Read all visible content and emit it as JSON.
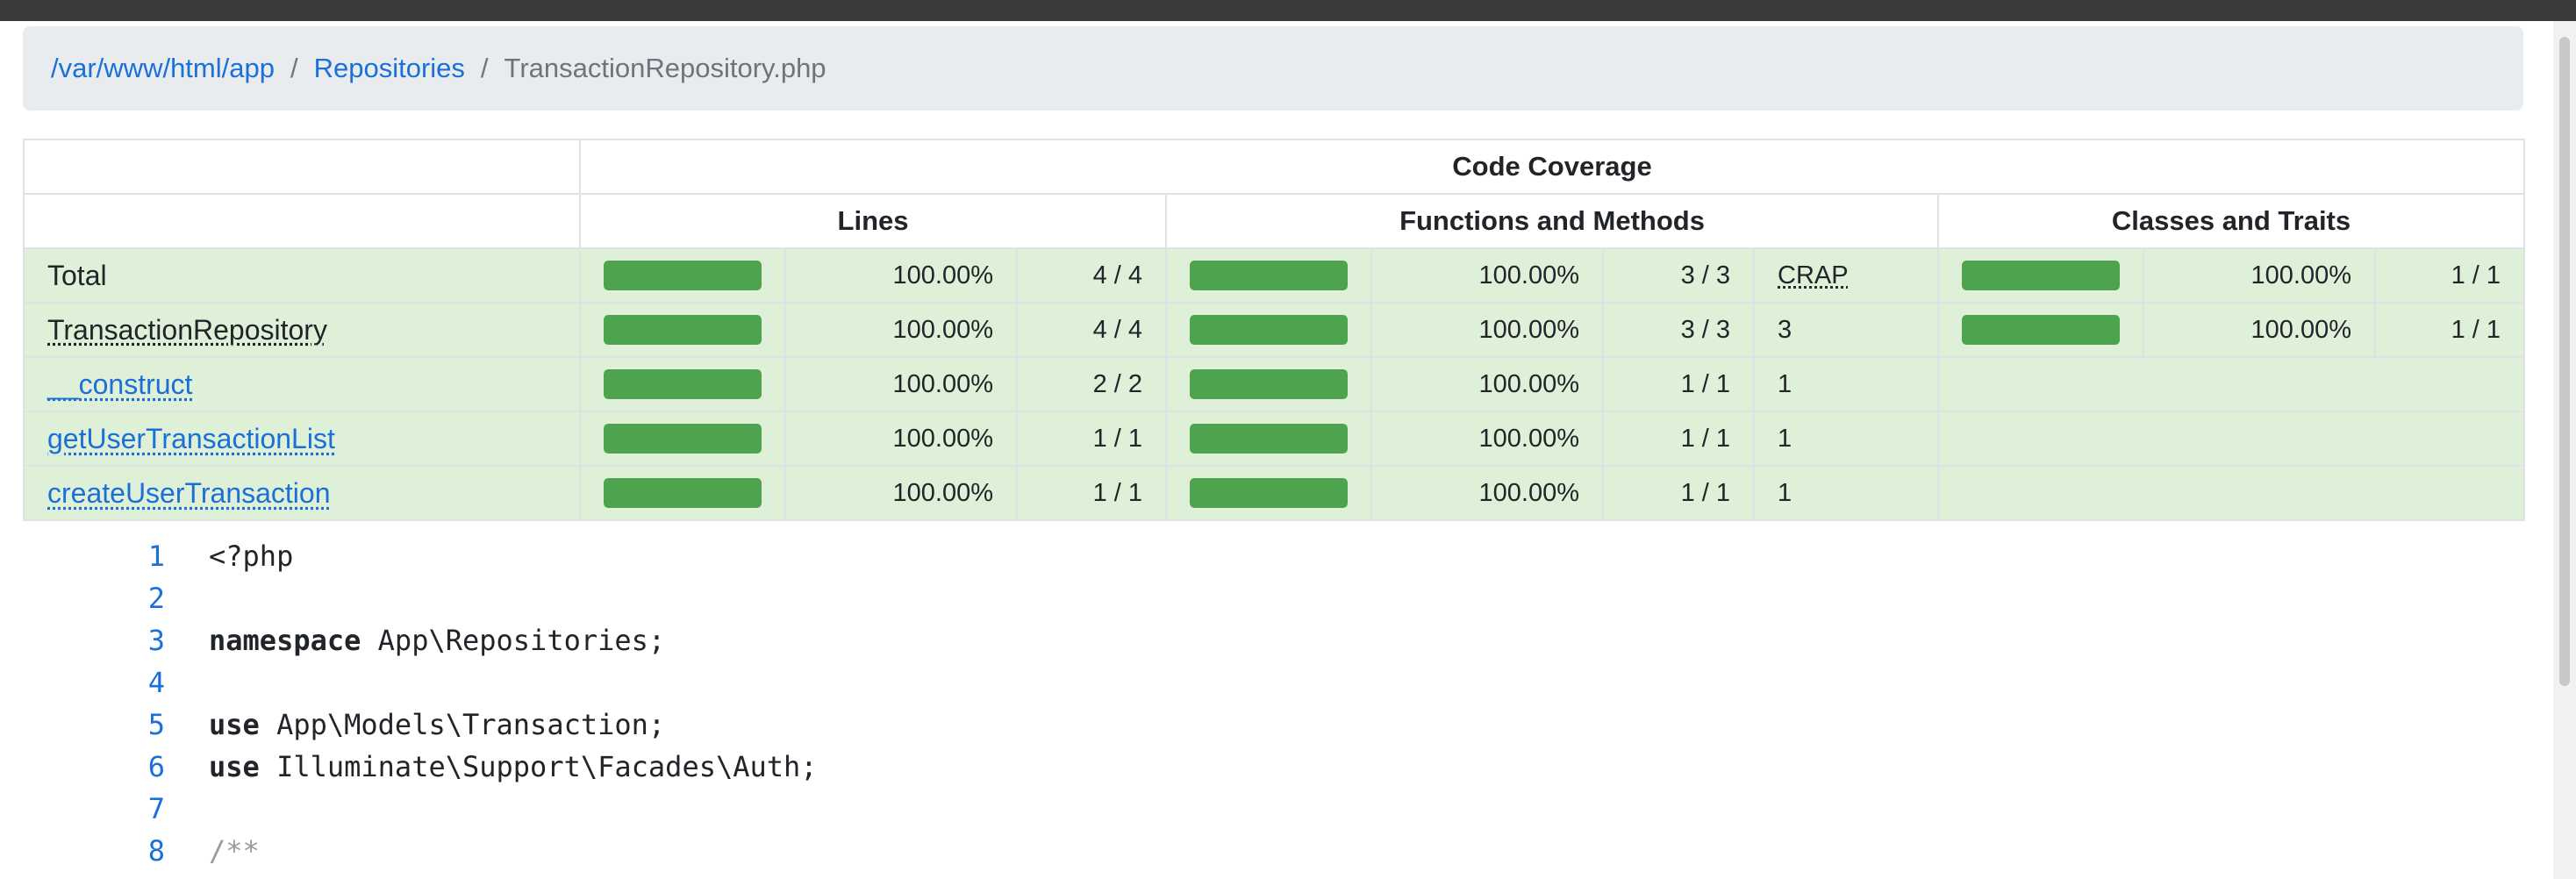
{
  "breadcrumb": {
    "root": "/var/www/html/app",
    "folder": "Repositories",
    "current": "TransactionRepository.php",
    "separator": "/"
  },
  "table": {
    "header_main": "Code Coverage",
    "columns": {
      "lines": "Lines",
      "functions": "Functions and Methods",
      "classes": "Classes and Traits"
    },
    "rows": [
      {
        "name": "Total",
        "lines_pct": "100.00%",
        "lines_ratio": "4 / 4",
        "lines_fill": 1.0,
        "fn_pct": "100.00%",
        "fn_ratio": "3 / 3",
        "crap": "CRAP",
        "fn_fill": 1.0,
        "cls_pct": "100.00%",
        "cls_ratio": "1 / 1",
        "cls_fill": 1.0
      },
      {
        "name": "TransactionRepository",
        "lines_pct": "100.00%",
        "lines_ratio": "4 / 4",
        "lines_fill": 1.0,
        "fn_pct": "100.00%",
        "fn_ratio": "3 / 3",
        "crap": "3",
        "fn_fill": 1.0,
        "cls_pct": "100.00%",
        "cls_ratio": "1 / 1",
        "cls_fill": 1.0
      },
      {
        "name": "__construct",
        "lines_pct": "100.00%",
        "lines_ratio": "2 / 2",
        "lines_fill": 1.0,
        "fn_pct": "100.00%",
        "fn_ratio": "1 / 1",
        "crap": "1",
        "fn_fill": 1.0
      },
      {
        "name": "getUserTransactionList",
        "lines_pct": "100.00%",
        "lines_ratio": "1 / 1",
        "lines_fill": 1.0,
        "fn_pct": "100.00%",
        "fn_ratio": "1 / 1",
        "crap": "1",
        "fn_fill": 1.0
      },
      {
        "name": "createUserTransaction",
        "lines_pct": "100.00%",
        "lines_ratio": "1 / 1",
        "lines_fill": 1.0,
        "fn_pct": "100.00%",
        "fn_ratio": "1 / 1",
        "crap": "1",
        "fn_fill": 1.0
      }
    ]
  },
  "code": {
    "lines": [
      {
        "n": "1",
        "kw": "",
        "text": "<?php"
      },
      {
        "n": "2",
        "kw": "",
        "text": ""
      },
      {
        "n": "3",
        "kw": "namespace",
        "text": " App\\Repositories;"
      },
      {
        "n": "4",
        "kw": "",
        "text": ""
      },
      {
        "n": "5",
        "kw": "use",
        "text": " App\\Models\\Transaction;"
      },
      {
        "n": "6",
        "kw": "use",
        "text": " Illuminate\\Support\\Facades\\Auth;"
      },
      {
        "n": "7",
        "kw": "",
        "text": ""
      },
      {
        "n": "8",
        "kw": "",
        "comment": "/**",
        "text": ""
      }
    ]
  },
  "colors": {
    "success_row": "#dff0d8",
    "bar_fill": "#4ea44e",
    "link": "#1a6fd8"
  }
}
